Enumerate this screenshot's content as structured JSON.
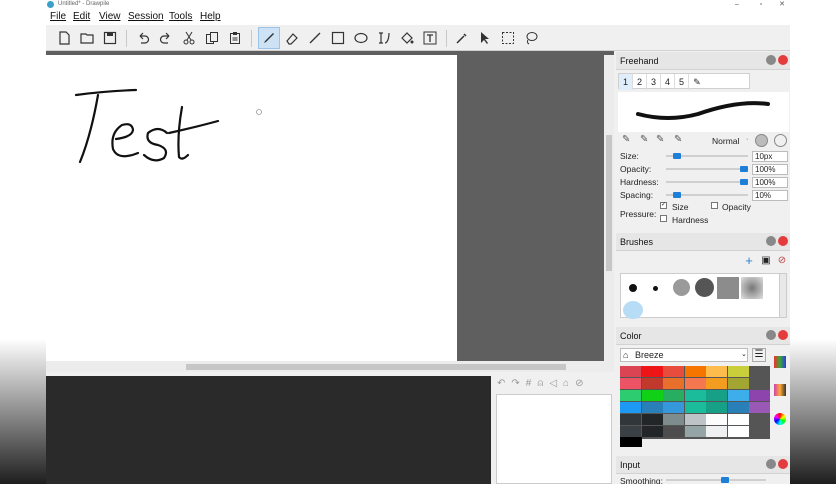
{
  "window": {
    "title": "Untitled* - Drawpile",
    "controls": [
      "–",
      "▫",
      "✕"
    ]
  },
  "menu": [
    "File",
    "Edit",
    "View",
    "Session",
    "Tools",
    "Help"
  ],
  "menu_accel": [
    "F",
    "E",
    "V",
    "S",
    "T",
    "H"
  ],
  "toolbar": {
    "tools": [
      "new-icon",
      "open-icon",
      "save-icon",
      "undo-icon",
      "redo-icon",
      "cut-icon",
      "copy-icon",
      "paste-icon",
      "freehand-icon",
      "eraser-icon",
      "line-icon",
      "rectangle-icon",
      "ellipse-icon",
      "bezier-icon",
      "fill-icon",
      "text-icon",
      "color-picker-icon",
      "select-arrow-icon",
      "rect-select-icon",
      "lasso-icon"
    ],
    "active": "freehand-icon"
  },
  "canvas": {
    "drawn_text": "Test"
  },
  "freehand": {
    "title": "Freehand",
    "tabs": [
      "1",
      "2",
      "3",
      "4",
      "5"
    ],
    "blend_mode": "Normal",
    "size_label": "Size:",
    "size_value": "10px",
    "size_fraction": 0.1,
    "opacity_label": "Opacity:",
    "opacity_value": "100%",
    "opacity_fraction": 1.0,
    "hardness_label": "Hardness:",
    "hardness_value": "100%",
    "hardness_fraction": 1.0,
    "spacing_label": "Spacing:",
    "spacing_value": "10%",
    "spacing_fraction": 0.1,
    "pressure_label": "Pressure:",
    "pressure_size": "Size",
    "pressure_opacity": "Opacity",
    "pressure_hardness": "Hardness",
    "pressure_size_checked": true,
    "pressure_opacity_checked": false,
    "pressure_hardness_checked": false
  },
  "brushes": {
    "title": "Brushes"
  },
  "color": {
    "title": "Color",
    "palette_name": "Breeze",
    "swatches": [
      [
        "#da4453",
        "#ed1515",
        "#e74c3c",
        "#f67400",
        "#fdbc4b",
        "#c9ce3b",
        "#555555"
      ],
      [
        "#ec5466",
        "#c0392b",
        "#e8702b",
        "#f47750",
        "#f39c1f",
        "#a3a533",
        "#555555"
      ],
      [
        "#2ecc71",
        "#11d116",
        "#27ae60",
        "#1abc9c",
        "#16a085",
        "#3daee9",
        "#8e44ad"
      ],
      [
        "#1d99f3",
        "#2980b9",
        "#3498db",
        "#1abc9c",
        "#16a085",
        "#2980b9",
        "#9b59b6"
      ],
      [
        "#31363b",
        "#232629",
        "#7f8c8d",
        "#bdc3c7",
        "#fcfcfc",
        "#ffffff",
        "#555555"
      ],
      [
        "#3b4045",
        "#232629",
        "#4d4d4d",
        "#95a5a6",
        "#eff0f1",
        "#ffffff",
        "#555555"
      ]
    ],
    "current": "#000000"
  },
  "input": {
    "title": "Input",
    "smoothing_label": "Smoothing:"
  }
}
